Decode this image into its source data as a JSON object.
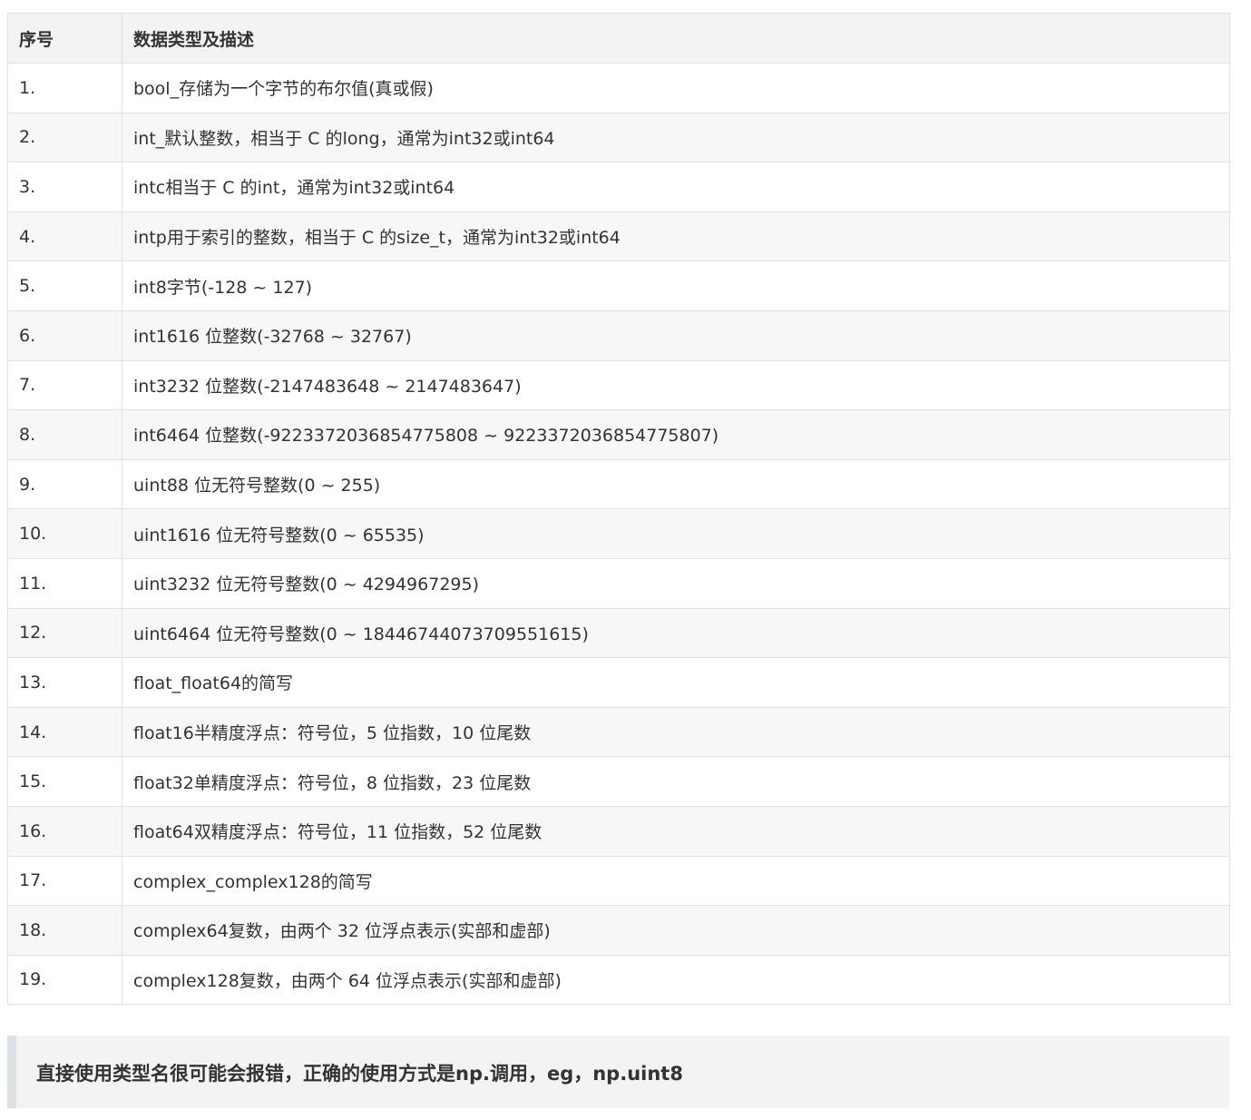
{
  "table": {
    "headers": [
      "序号",
      "数据类型及描述"
    ],
    "rows": [
      [
        "1.",
        "bool_存储为一个字节的布尔值(真或假)"
      ],
      [
        "2.",
        "int_默认整数，相当于 C 的long，通常为int32或int64"
      ],
      [
        "3.",
        "intc相当于 C 的int，通常为int32或int64"
      ],
      [
        "4.",
        "intp用于索引的整数，相当于 C 的size_t，通常为int32或int64"
      ],
      [
        "5.",
        "int8字节(-128 ~ 127)"
      ],
      [
        "6.",
        "int1616 位整数(-32768 ~ 32767)"
      ],
      [
        "7.",
        "int3232 位整数(-2147483648 ~ 2147483647)"
      ],
      [
        "8.",
        "int6464 位整数(-9223372036854775808 ~ 9223372036854775807)"
      ],
      [
        "9.",
        "uint88 位无符号整数(0 ~ 255)"
      ],
      [
        "10.",
        "uint1616 位无符号整数(0 ~ 65535)"
      ],
      [
        "11.",
        "uint3232 位无符号整数(0 ~ 4294967295)"
      ],
      [
        "12.",
        "uint6464 位无符号整数(0 ~ 18446744073709551615)"
      ],
      [
        "13.",
        "float_float64的简写"
      ],
      [
        "14.",
        "float16半精度浮点：符号位，5 位指数，10 位尾数"
      ],
      [
        "15.",
        "float32单精度浮点：符号位，8 位指数，23 位尾数"
      ],
      [
        "16.",
        "float64双精度浮点：符号位，11 位指数，52 位尾数"
      ],
      [
        "17.",
        "complex_complex128的简写"
      ],
      [
        "18.",
        "complex64复数，由两个 32 位浮点表示(实部和虚部)"
      ],
      [
        "19.",
        "complex128复数，由两个 64 位浮点表示(实部和虚部)"
      ]
    ]
  },
  "note": {
    "text": "直接使用类型名很可能会报错，正确的使用方式是np.调用，eg，np.uint8"
  }
}
